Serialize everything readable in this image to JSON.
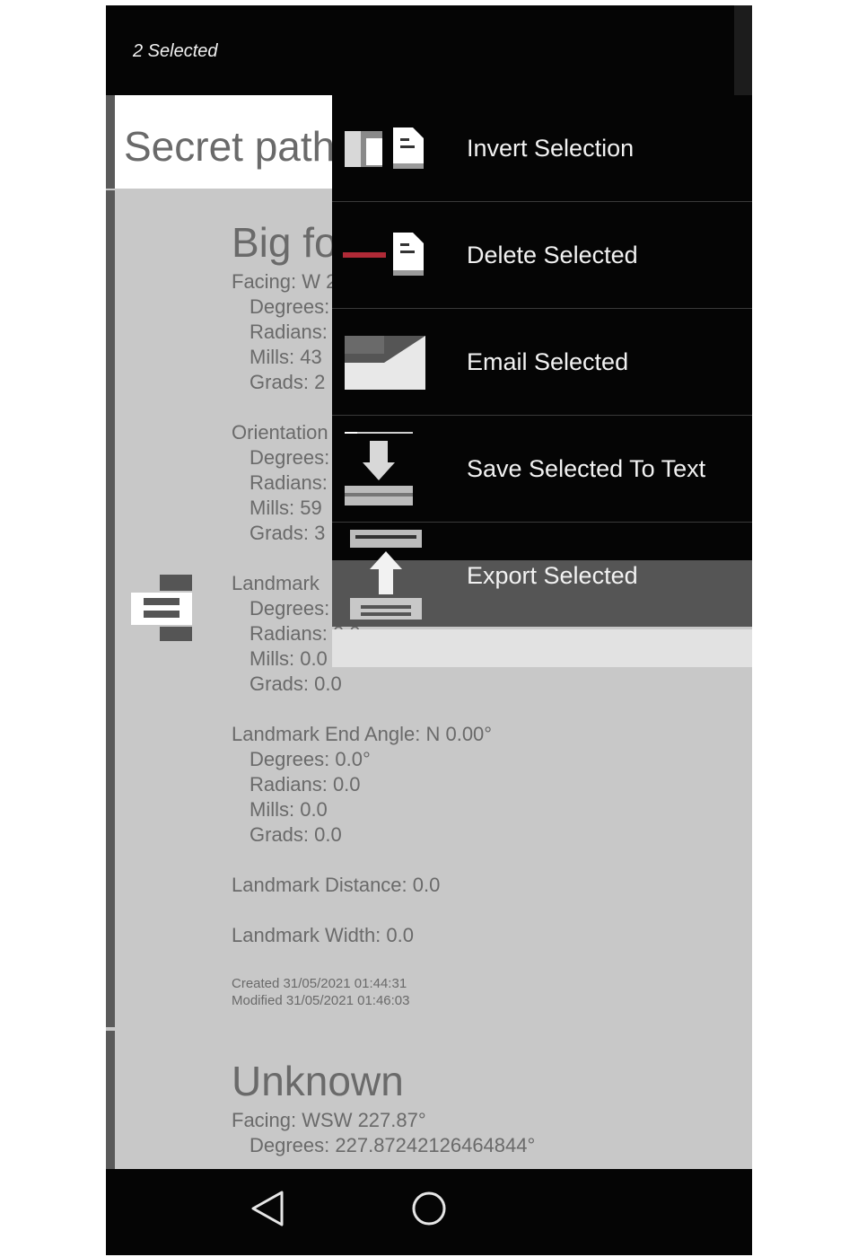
{
  "appbar": {
    "title": "2 Selected"
  },
  "items": [
    {
      "name": "Secret path"
    },
    {
      "name": "Big fo",
      "lines": [
        "Facing: W 2",
        "Degrees:",
        "Radians:",
        "Mills: 43",
        "Grads: 2",
        "Orientation",
        "Degrees:",
        "Radians:",
        "Mills: 59",
        "Grads: 3",
        "Landmark",
        "Degrees:",
        "Radians: 0.0",
        "Mills: 0.0",
        "Grads: 0.0",
        "Landmark End Angle: N 0.00°",
        "Degrees: 0.0°",
        "Radians: 0.0",
        "Mills: 0.0",
        "Grads: 0.0",
        "Landmark Distance: 0.0",
        "Landmark Width: 0.0"
      ],
      "created": "Created 31/05/2021 01:44:31",
      "modified": "Modified 31/05/2021 01:46:03"
    },
    {
      "name": "Unknown",
      "lines": [
        "Facing: WSW 227.87°",
        "Degrees: 227.87242126464844°"
      ]
    }
  ],
  "menu": {
    "items": [
      {
        "label": "Invert Selection",
        "icon": "invert-selection-icon"
      },
      {
        "label": "Delete Selected",
        "icon": "delete-selected-icon"
      },
      {
        "label": "Email Selected",
        "icon": "email-icon"
      },
      {
        "label": "Save Selected To Text",
        "icon": "save-to-text-icon"
      },
      {
        "label": "Export Selected",
        "icon": "export-icon"
      }
    ]
  },
  "navbar": {
    "back": "back-icon",
    "home": "home-icon"
  },
  "colors": {
    "menu_bg": "#050505",
    "highlight": "#555555",
    "list_bg": "#c8c8c8",
    "text": "#6a6a6a",
    "accent_red": "#b02a37"
  }
}
